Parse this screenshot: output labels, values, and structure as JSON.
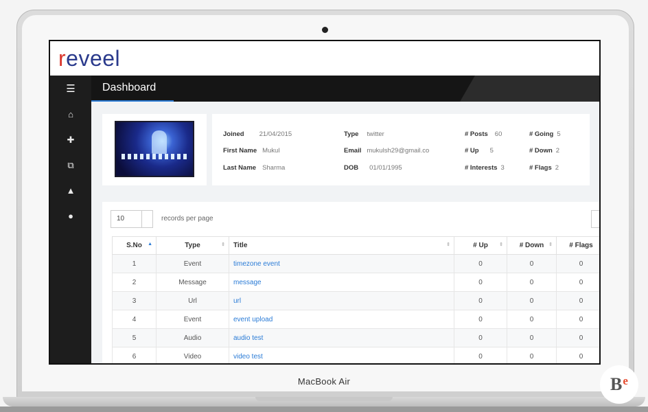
{
  "app": {
    "logo": {
      "r": "r",
      "rest": "eveel"
    },
    "page_title": "Dashboard"
  },
  "sidebar": {
    "menu_icon": "hamburger-icon",
    "items": [
      {
        "icon": "home-icon",
        "glyph": "⌂"
      },
      {
        "icon": "plus-icon",
        "glyph": "✚"
      },
      {
        "icon": "copy-icon",
        "glyph": "⧉"
      },
      {
        "icon": "warning-icon",
        "glyph": "▲"
      },
      {
        "icon": "user-icon",
        "glyph": "●"
      }
    ]
  },
  "profile": {
    "joined_label": "Joined",
    "joined": "21/04/2015",
    "first_name_label": "First Name",
    "first_name": "Mukul",
    "last_name_label": "Last Name",
    "last_name": "Sharma",
    "type_label": "Type",
    "type": "twitter",
    "email_label": "Email",
    "email": "mukulsh29@gmail.co",
    "dob_label": "DOB",
    "dob": "01/01/1995",
    "posts_label": "# Posts",
    "posts": "60",
    "up_label": "# Up",
    "up": "5",
    "interests_label": "# Interests",
    "interests": "3",
    "going_label": "# Going",
    "going": "5",
    "down_label": "# Down",
    "down": "2",
    "flags_label": "# Flags",
    "flags": "2"
  },
  "table": {
    "per_page_value": "10",
    "per_page_label": "records per page",
    "headers": {
      "sno": "S.No",
      "type": "Type",
      "title": "Title",
      "up": "# Up",
      "down": "# Down",
      "flags": "# Flags"
    },
    "rows": [
      {
        "sno": "1",
        "type": "Event",
        "title": "timezone event",
        "up": "0",
        "down": "0",
        "flags": "0"
      },
      {
        "sno": "2",
        "type": "Message",
        "title": "message",
        "up": "0",
        "down": "0",
        "flags": "0"
      },
      {
        "sno": "3",
        "type": "Url",
        "title": "url",
        "up": "0",
        "down": "0",
        "flags": "0"
      },
      {
        "sno": "4",
        "type": "Event",
        "title": "event upload",
        "up": "0",
        "down": "0",
        "flags": "0"
      },
      {
        "sno": "5",
        "type": "Audio",
        "title": "audio test",
        "up": "0",
        "down": "0",
        "flags": "0"
      },
      {
        "sno": "6",
        "type": "Video",
        "title": "video test",
        "up": "0",
        "down": "0",
        "flags": "0"
      }
    ]
  },
  "device": {
    "model": "MacBook Air"
  },
  "watermark": {
    "main": "B",
    "sup": "e"
  }
}
